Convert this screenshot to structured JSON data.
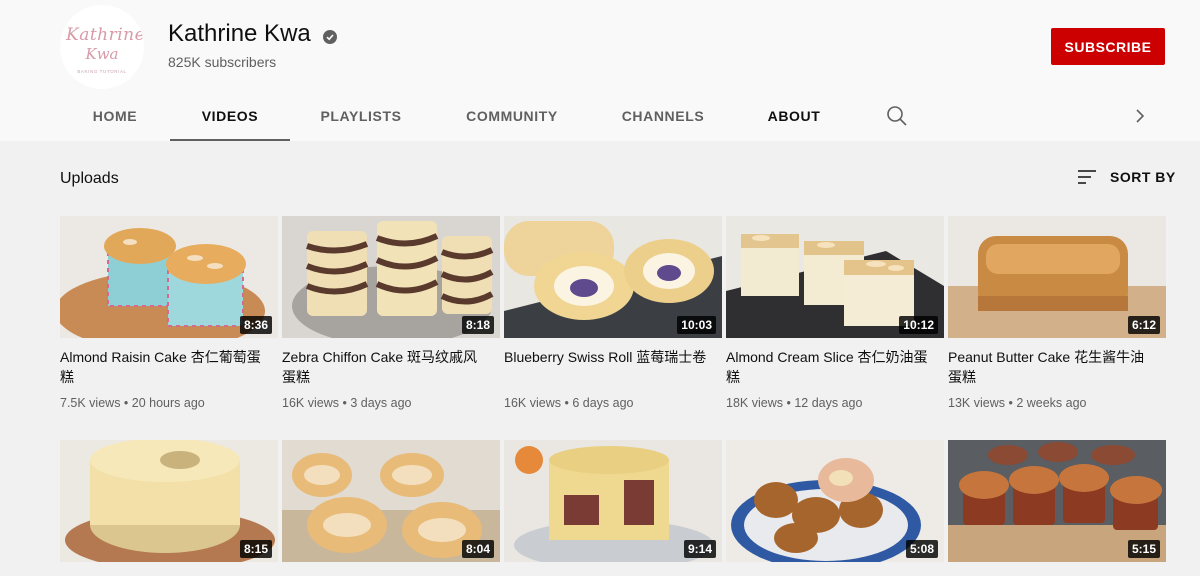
{
  "channel": {
    "name": "Kathrine Kwa",
    "subscribers": "825K subscribers",
    "subscribe_label": "SUBSCRIBE",
    "logo_text_1": "Kathrine",
    "logo_text_2": "Kwa",
    "logo_text_3": "BAKING TUTORIAL"
  },
  "tabs": [
    "HOME",
    "VIDEOS",
    "PLAYLISTS",
    "COMMUNITY",
    "CHANNELS",
    "ABOUT"
  ],
  "active_tab": "VIDEOS",
  "section": {
    "title": "Uploads",
    "sort_label": "SORT BY"
  },
  "videos": [
    {
      "title": "Almond Raisin Cake 杏仁葡萄蛋糕",
      "duration": "8:36",
      "views": "7.5K views",
      "age": "20 hours ago"
    },
    {
      "title": "Zebra Chiffon Cake 斑马纹戚风蛋糕",
      "duration": "8:18",
      "views": "16K views",
      "age": "3 days ago"
    },
    {
      "title": "Blueberry Swiss Roll 蓝莓瑞士卷",
      "duration": "10:03",
      "views": "16K views",
      "age": "6 days ago"
    },
    {
      "title": "Almond Cream Slice 杏仁奶油蛋糕",
      "duration": "10:12",
      "views": "18K views",
      "age": "12 days ago"
    },
    {
      "title": "Peanut Butter Cake 花生酱牛油蛋糕",
      "duration": "6:12",
      "views": "13K views",
      "age": "2 weeks ago"
    },
    {
      "title": "",
      "duration": "8:15",
      "views": "",
      "age": ""
    },
    {
      "title": "",
      "duration": "8:04",
      "views": "",
      "age": ""
    },
    {
      "title": "",
      "duration": "9:14",
      "views": "",
      "age": ""
    },
    {
      "title": "",
      "duration": "5:08",
      "views": "",
      "age": ""
    },
    {
      "title": "",
      "duration": "5:15",
      "views": "",
      "age": ""
    }
  ],
  "icons": {
    "verified": "verified-check-icon",
    "search": "search-icon",
    "next": "chevron-right-icon",
    "sort": "sort-icon"
  },
  "colors": {
    "subscribe": "#cc0000",
    "header_bg": "#f9f9f9",
    "content_bg": "#f1f1f1",
    "meta_text": "#606060"
  }
}
